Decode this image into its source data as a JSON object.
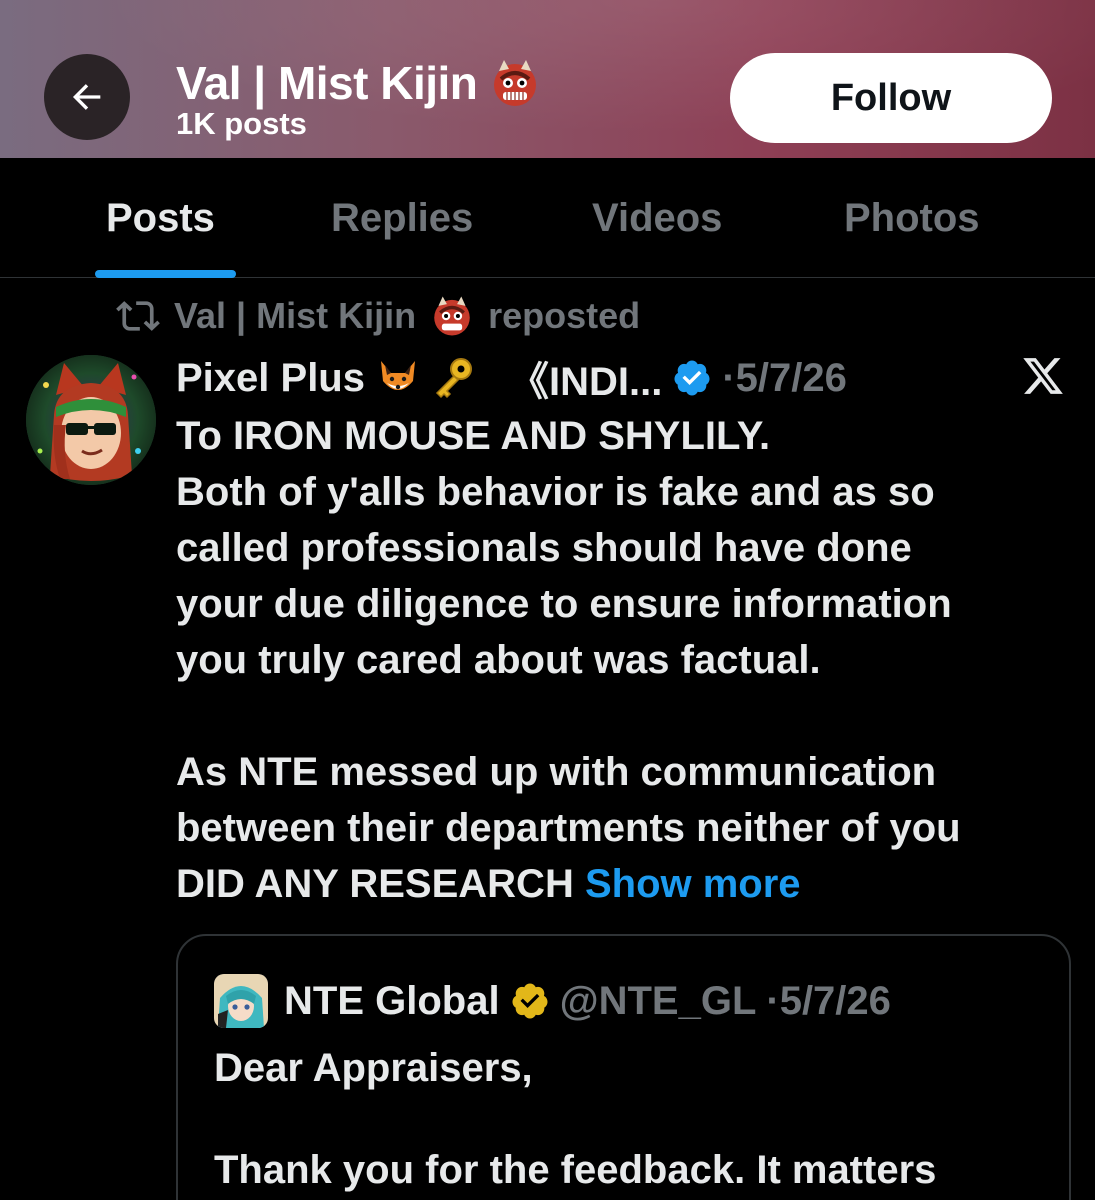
{
  "header": {
    "profile_name": "Val | Mist Kijin",
    "post_count": "1K posts",
    "follow_label": "Follow",
    "back_icon": "arrow-left-icon",
    "name_emoji": "japanese-ogre-emoji",
    "background_colors": [
      "#7a6c80",
      "#8e3f55"
    ]
  },
  "tabs": [
    {
      "label": "Posts",
      "active": true
    },
    {
      "label": "Replies",
      "active": false
    },
    {
      "label": "Videos",
      "active": false
    },
    {
      "label": "Photos",
      "active": false
    }
  ],
  "post": {
    "repost_name": "Val | Mist Kijin",
    "repost_suffix": "reposted",
    "author_name": "Pixel Plus",
    "author_emojis": [
      "fox-emoji",
      "key-emoji"
    ],
    "author_truncated": "《INDI...",
    "verified": true,
    "date": "·5/7/26",
    "body_lines": [
      "To IRON MOUSE AND SHYLILY.",
      "Both of y'alls behavior is fake and as so",
      "called professionals should have done",
      "your due diligence to ensure information",
      "you truly cared about was factual."
    ],
    "body_lines_2": [
      "As NTE messed up with communication",
      "between their departments neither of you"
    ],
    "last_line": "DID ANY RESEARCH",
    "show_more": "Show more",
    "quote": {
      "name": "NTE Global",
      "handle": "@NTE_GL",
      "date": "·5/7/26",
      "line_1": "Dear Appraisers,",
      "line_2": "Thank you for the feedback. It matters"
    }
  },
  "colors": {
    "accent": "#1d9bf0",
    "muted": "#71767b",
    "text": "#e7e9ea",
    "gold_badge": "#e2b719"
  }
}
